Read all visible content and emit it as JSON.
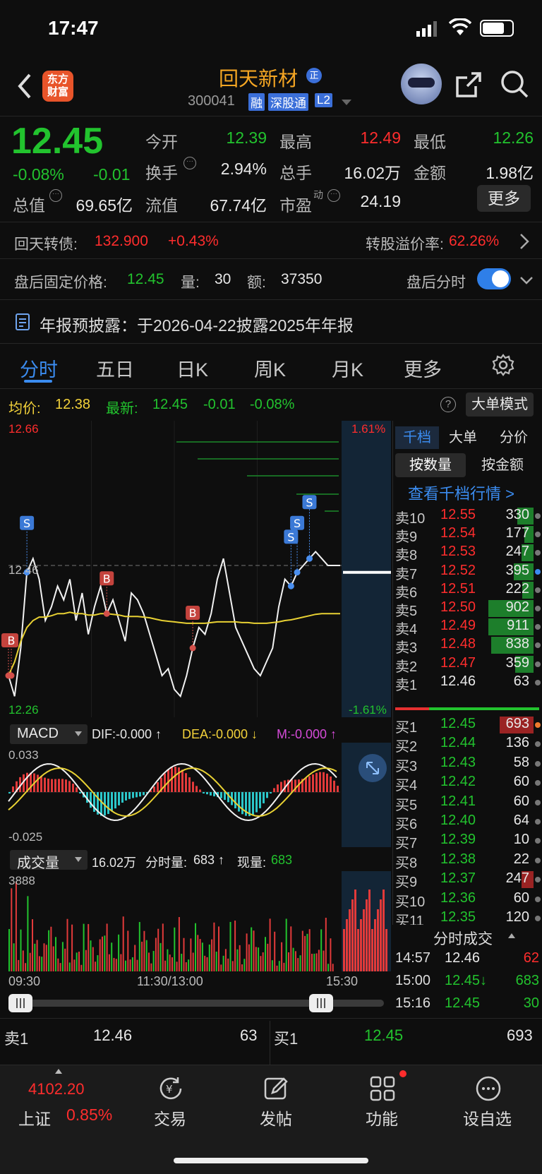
{
  "status_bar": {
    "time": "17:47"
  },
  "header": {
    "logo_text_1": "东方",
    "logo_text_2": "财富",
    "title": "回天新材",
    "title_badge": "正",
    "code": "300041",
    "tags": [
      "融",
      "深股通",
      "L2"
    ]
  },
  "quote": {
    "price": "12.45",
    "change_pct": "-0.08%",
    "change": "-0.01",
    "stats": [
      {
        "label": "今开",
        "value": "12.39",
        "color": "green"
      },
      {
        "label": "最高",
        "value": "12.49",
        "color": "red"
      },
      {
        "label": "最低",
        "value": "12.26",
        "color": "green"
      },
      {
        "label": "换手",
        "value": "2.94%",
        "color": "white"
      },
      {
        "label": "总手",
        "value": "16.02万",
        "color": "white"
      },
      {
        "label": "金额",
        "value": "1.98亿",
        "color": "white"
      },
      {
        "label": "总值",
        "value": "69.65亿",
        "color": "white"
      },
      {
        "label": "流值",
        "value": "67.74亿",
        "color": "white"
      },
      {
        "label": "市盈",
        "value": "24.19",
        "color": "white"
      }
    ],
    "pe_sup": "动",
    "more_label": "更多"
  },
  "bond": {
    "label": "回天转债:",
    "price": "132.900",
    "change": "+0.43%",
    "premium_label": "转股溢价率:",
    "premium": "62.26%"
  },
  "after_hours": {
    "fixed_label": "盘后固定价格:",
    "price": "12.45",
    "vol_label": "量:",
    "vol": "30",
    "amt_label": "额:",
    "amt": "37350",
    "toggle_label": "盘后分时",
    "toggle_on": true
  },
  "notice": {
    "text": "年报预披露：于2026-04-22披露2025年年报"
  },
  "chart_tabs": {
    "items": [
      "分时",
      "五日",
      "日K",
      "周K",
      "月K",
      "更多"
    ],
    "active": 0
  },
  "chart_header": {
    "avg_label": "均价:",
    "avg": "12.38",
    "latest_label": "最新:",
    "latest": "12.45",
    "chg": "-0.01",
    "chg_pct": "-0.08%",
    "mode_label": "大单模式"
  },
  "chart_data": {
    "type": "line",
    "title": "",
    "y_top_label": "12.66",
    "y_bottom_label": "12.26",
    "y_mid_label": "12.46",
    "pct_top_label": "1.61%",
    "pct_bottom_label": "-1.61%",
    "ylim": [
      12.26,
      12.66
    ],
    "prev_close": 12.46,
    "x_labels": [
      "09:30",
      "11:30/13:00",
      "15:30"
    ],
    "series": [
      {
        "name": "",
        "values": [
          12.3,
          12.27,
          12.34,
          12.45,
          12.47,
          12.44,
          12.38,
          12.4,
          12.43,
          12.41,
          12.44,
          12.38,
          12.42,
          12.36,
          12.4,
          12.43,
          12.39,
          12.41,
          12.38,
          12.35,
          12.42,
          12.41,
          12.39,
          12.36,
          12.33,
          12.3,
          12.31,
          12.28,
          12.27,
          12.3,
          12.34,
          12.37,
          12.36,
          12.39,
          12.44,
          12.47,
          12.42,
          12.37,
          12.35,
          12.33,
          12.31,
          12.3,
          12.32,
          12.34,
          12.4,
          12.44,
          12.43,
          12.45,
          12.46,
          12.47,
          12.48,
          12.47,
          12.46,
          12.46,
          12.46
        ]
      },
      {
        "name": "均价",
        "values": [
          12.3,
          12.32,
          12.35,
          12.37,
          12.38,
          12.385,
          12.385,
          12.387,
          12.39,
          12.39,
          12.392,
          12.39,
          12.39,
          12.388,
          12.388,
          12.39,
          12.39,
          12.389,
          12.388,
          12.386,
          12.386,
          12.386,
          12.385,
          12.384,
          12.382,
          12.38,
          12.379,
          12.378,
          12.377,
          12.376,
          12.376,
          12.376,
          12.376,
          12.377,
          12.378,
          12.378,
          12.378,
          12.378,
          12.377,
          12.377,
          12.376,
          12.376,
          12.376,
          12.377,
          12.378,
          12.38,
          12.381,
          12.383,
          12.385,
          12.387,
          12.389,
          12.39,
          12.39,
          12.39,
          12.39
        ]
      }
    ],
    "markers": [
      {
        "label": "S",
        "type": "sell"
      },
      {
        "label": "B",
        "type": "buy"
      },
      {
        "label": "B",
        "type": "buy"
      },
      {
        "label": "B",
        "type": "buy"
      },
      {
        "label": "B",
        "type": "buy"
      },
      {
        "label": "S",
        "type": "sell"
      },
      {
        "label": "S",
        "type": "sell"
      },
      {
        "label": "S",
        "type": "sell"
      }
    ],
    "macd": {
      "label": "MACD",
      "dif": "DIF:-0.000 ↑",
      "dea": "DEA:-0.000 ↓",
      "m": "M:-0.000 ↑",
      "top_label": "0.033",
      "bottom_label": "-0.025"
    },
    "volume": {
      "label": "成交量",
      "total": "16.02万",
      "split_label": "分时量:",
      "split": "683 ↑",
      "now_label": "现量:",
      "now": "683",
      "top_label": "3888"
    }
  },
  "order_book": {
    "tabs": [
      "千档",
      "大单",
      "分价"
    ],
    "active_tab": 0,
    "mode_tabs": [
      "按数量",
      "按金额"
    ],
    "link": "查看千档行情 >",
    "asks": [
      {
        "label": "卖10",
        "price": "12.55",
        "vol": "330",
        "fill": 0.36
      },
      {
        "label": "卖9",
        "price": "12.54",
        "vol": "177",
        "fill": 0.2
      },
      {
        "label": "卖8",
        "price": "12.53",
        "vol": "247",
        "fill": 0.27
      },
      {
        "label": "卖7",
        "price": "12.52",
        "vol": "395",
        "fill": 0.44
      },
      {
        "label": "卖6",
        "price": "12.51",
        "vol": "222",
        "fill": 0.25
      },
      {
        "label": "卖5",
        "price": "12.50",
        "vol": "902",
        "fill": 1.0
      },
      {
        "label": "卖4",
        "price": "12.49",
        "vol": "911",
        "fill": 1.0
      },
      {
        "label": "卖3",
        "price": "12.48",
        "vol": "838",
        "fill": 0.93
      },
      {
        "label": "卖2",
        "price": "12.47",
        "vol": "359",
        "fill": 0.4
      },
      {
        "label": "卖1",
        "price": "12.46",
        "vol": "63",
        "fill": 0.0
      }
    ],
    "bids": [
      {
        "label": "买1",
        "price": "12.45",
        "vol": "693",
        "fill": 0.75
      },
      {
        "label": "买2",
        "price": "12.44",
        "vol": "136",
        "fill": 0.0
      },
      {
        "label": "买3",
        "price": "12.43",
        "vol": "58",
        "fill": 0.0
      },
      {
        "label": "买4",
        "price": "12.42",
        "vol": "60",
        "fill": 0.0
      },
      {
        "label": "买5",
        "price": "12.41",
        "vol": "60",
        "fill": 0.0
      },
      {
        "label": "买6",
        "price": "12.40",
        "vol": "64",
        "fill": 0.0
      },
      {
        "label": "买7",
        "price": "12.39",
        "vol": "10",
        "fill": 0.0
      },
      {
        "label": "买8",
        "price": "12.38",
        "vol": "22",
        "fill": 0.0
      },
      {
        "label": "买9",
        "price": "12.37",
        "vol": "247",
        "fill": 0.27
      },
      {
        "label": "买10",
        "price": "12.36",
        "vol": "60",
        "fill": 0.0
      },
      {
        "label": "买11",
        "price": "12.35",
        "vol": "120",
        "fill": 0.0
      }
    ],
    "ticks_title": "分时成交",
    "ticks": [
      {
        "time": "14:57",
        "price": "12.46",
        "vol": "62"
      },
      {
        "time": "15:00",
        "price": "12.45↓",
        "vol": "683"
      },
      {
        "time": "15:16",
        "price": "12.45",
        "vol": "30"
      }
    ]
  },
  "bottom_quote": {
    "ask_label": "卖1",
    "ask_price": "12.46",
    "ask_vol": "63",
    "bid_label": "买1",
    "bid_price": "12.45",
    "bid_vol": "693"
  },
  "bottom_nav": {
    "index_value": "4102.20",
    "index_name": "上证",
    "index_pct": "0.85%",
    "items": [
      "交易",
      "发帖",
      "功能",
      "设自选"
    ]
  },
  "colors": {
    "red": "#ff2d2d",
    "green": "#22c32e",
    "blue": "#3b8cf0",
    "accent_orange": "#f5a623"
  }
}
